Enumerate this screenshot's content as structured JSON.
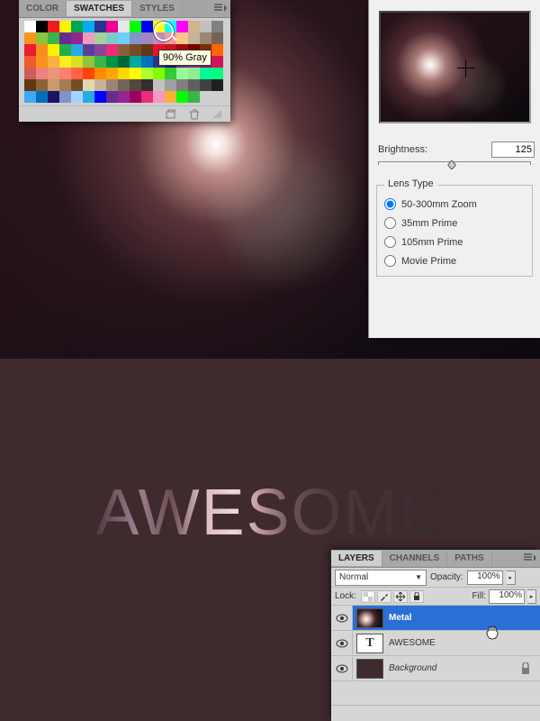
{
  "swatches": {
    "tabs": [
      "COLOR",
      "SWATCHES",
      "STYLES"
    ],
    "active_tab": 1,
    "tooltip": "90% Gray",
    "colors": [
      "#ffffff",
      "#000000",
      "#ed1c24",
      "#fff200",
      "#00a651",
      "#00aeef",
      "#2e3192",
      "#ec008c",
      "#e6e7e8",
      "#00ff00",
      "#0000ff",
      "#ffff00",
      "#00ffff",
      "#ff00ff",
      "#d2b48c",
      "#c0c0c0",
      "#808080",
      "#f7941d",
      "#8bc53f",
      "#39b54a",
      "#662d91",
      "#92278f",
      "#f49ac1",
      "#a3d39c",
      "#7accc8",
      "#6dcff6",
      "#8393ca",
      "#a186be",
      "#bd8cbf",
      "#f5989d",
      "#fdc689",
      "#c7b299",
      "#998675",
      "#736357",
      "#ec1b30",
      "#f58f20",
      "#fef200",
      "#21b14b",
      "#25aae1",
      "#584099",
      "#89449b",
      "#ee2a7b",
      "#8b5e3c",
      "#754c28",
      "#603913",
      "#e8112d",
      "#c4161c",
      "#9e0b0f",
      "#790000",
      "#7b2e00",
      "#ff6600",
      "#f15a29",
      "#f7941e",
      "#fbb040",
      "#fcee21",
      "#d9e021",
      "#8cc63f",
      "#39b54a",
      "#009444",
      "#006837",
      "#00a99d",
      "#0071bc",
      "#2e3192",
      "#1b1464",
      "#662d91",
      "#93278f",
      "#9e005d",
      "#d4145a",
      "#cd5c5c",
      "#f08080",
      "#e9967a",
      "#fa8072",
      "#ff6347",
      "#ff4500",
      "#ff8c00",
      "#ffa500",
      "#ffd700",
      "#ffff00",
      "#adff2f",
      "#7fff00",
      "#32cd32",
      "#98fb98",
      "#90ee90",
      "#00fa9a",
      "#00ff7f",
      "#603913",
      "#8c6239",
      "#c69c6d",
      "#a67c52",
      "#754c24",
      "#e2d8b0",
      "#c7b299",
      "#998675",
      "#736357",
      "#534741",
      "#362f2d",
      "#c2c2c2",
      "#a0a0a0",
      "#808080",
      "#606060",
      "#404040",
      "#202020",
      "#3fa9f5",
      "#0071bc",
      "#1b1464",
      "#8393ca",
      "#a3d4ff",
      "#29abe2",
      "#0000ff",
      "#662d91",
      "#93278f",
      "#9e005d",
      "#ee2a7b",
      "#f49ac1",
      "#fbb03b",
      "#00ff00",
      "#39b54a",
      ""
    ]
  },
  "lens_flare": {
    "brightness_label": "Brightness:",
    "brightness_value": "125",
    "lens_type_legend": "Lens Type",
    "options": [
      "50-300mm Zoom",
      "35mm Prime",
      "105mm Prime",
      "Movie Prime"
    ],
    "selected": 0
  },
  "canvas": {
    "awesome_text": "AWESOME"
  },
  "layers": {
    "tabs": [
      "LAYERS",
      "CHANNELS",
      "PATHS"
    ],
    "active_tab": 0,
    "blend_mode": "Normal",
    "opacity_label": "Opacity:",
    "opacity_value": "100%",
    "lock_label": "Lock:",
    "fill_label": "Fill:",
    "fill_value": "100%",
    "items": [
      {
        "name": "Metal",
        "type": "image",
        "selected": true,
        "locked": false
      },
      {
        "name": "AWESOME",
        "type": "text",
        "selected": false,
        "locked": false
      },
      {
        "name": "Background",
        "type": "bg",
        "selected": false,
        "locked": true
      }
    ]
  }
}
